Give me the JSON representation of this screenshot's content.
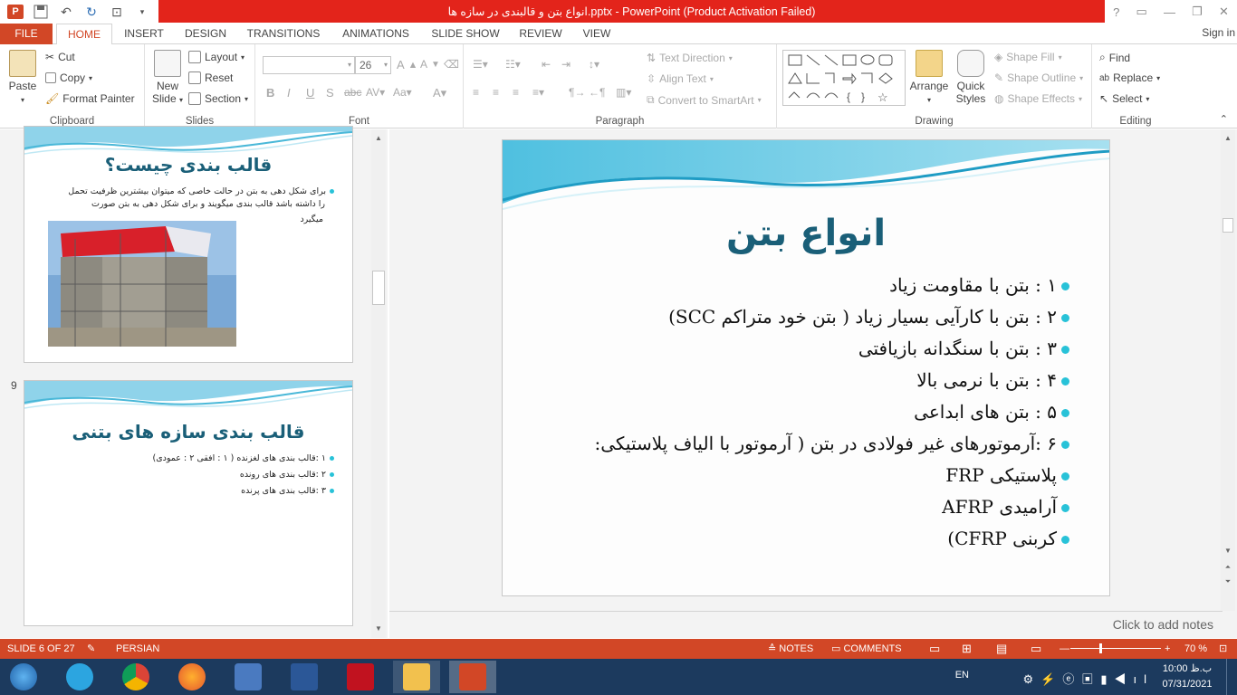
{
  "window": {
    "title": "انواع بتن و قالبندی در سازه ها.pptx - PowerPoint (Product Activation Failed)",
    "controls": [
      "?",
      "▭",
      "—",
      "❐",
      "✕"
    ]
  },
  "tabs": [
    "FILE",
    "HOME",
    "INSERT",
    "DESIGN",
    "TRANSITIONS",
    "ANIMATIONS",
    "SLIDE SHOW",
    "REVIEW",
    "VIEW"
  ],
  "signin": "Sign in",
  "ribbon": {
    "clipboard": {
      "label": "Clipboard",
      "paste": "Paste",
      "cut": "Cut",
      "copy": "Copy",
      "format_painter": "Format Painter"
    },
    "slides": {
      "label": "Slides",
      "new_slide": "New Slide",
      "layout": "Layout",
      "reset": "Reset",
      "section": "Section"
    },
    "font": {
      "label": "Font",
      "size": "26"
    },
    "paragraph": {
      "label": "Paragraph",
      "text_direction": "Text Direction",
      "align_text": "Align Text",
      "convert_smartart": "Convert to SmartArt"
    },
    "drawing": {
      "label": "Drawing",
      "arrange": "Arrange",
      "quick_styles": "Quick Styles",
      "shape_fill": "Shape Fill",
      "shape_outline": "Shape Outline",
      "shape_effects": "Shape Effects"
    },
    "editing": {
      "label": "Editing",
      "find": "Find",
      "replace": "Replace",
      "select": "Select"
    }
  },
  "thumbnails": {
    "slide8": {
      "title": "قالب بندی چیست؟",
      "text": [
        "برای شکل دهی به بتن در حالت خاصی که میتوان بیشترین ظرفیت تحمل",
        "را داشته باشد قالب بندی میگویند و برای شکل دهی به بتن صورت",
        "میگیرد"
      ]
    },
    "slide9": {
      "number": "9",
      "title": "قالب بندی سازه های بتنی",
      "items": [
        "۱ :قالب بندی های لغزنده ( ۱ : افقی ۲ : عمودی)",
        "۲ :قالب بندی های رونده",
        "۳ :قالب بندی های پرنده"
      ]
    }
  },
  "slide": {
    "title": "انواع بتن",
    "bullets": [
      "۱ : بتن با مقاومت زیاد",
      "۲ : بتن با کارآیی بسیار زیاد ( بتن خود متراکم SCC)",
      "۳ : بتن با سنگدانه بازیافتی",
      "۴ : بتن با نرمی بالا",
      "۵ : بتن های ابداعی",
      "۶ :آرموتورهای غیر فولادی در بتن ( آرموتور با الیاف پلاستیکی:",
      "پلاستیکی FRP",
      "آرامیدی AFRP",
      "کربنی CFRP)"
    ]
  },
  "notes_placeholder": "Click to add notes",
  "status": {
    "slide": "SLIDE 6 OF 27",
    "language": "PERSIAN",
    "notes": "NOTES",
    "comments": "COMMENTS",
    "zoom": "70 %"
  },
  "tray": {
    "lang": "EN",
    "time": "10:00 ب.ظ",
    "date": "07/31/2021"
  },
  "colors": {
    "accent": "#d24726",
    "title_red": "#e3241b",
    "slide_title": "#1a5f78",
    "bullet": "#28c2d8"
  }
}
